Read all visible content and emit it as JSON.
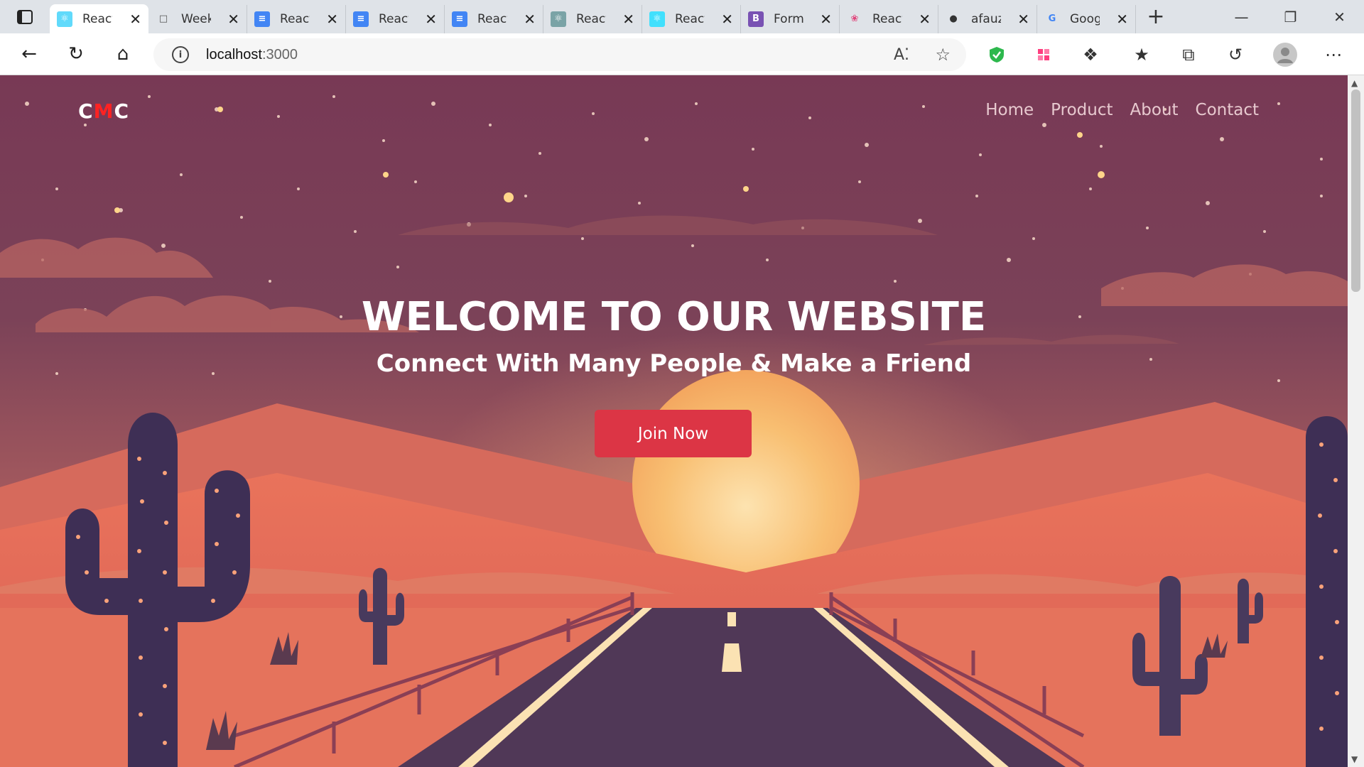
{
  "browser": {
    "tabs": [
      {
        "title": "React",
        "icon": "react-icon",
        "color": "#61dafb",
        "active": true
      },
      {
        "title": "Weekly",
        "icon": "page-icon",
        "color": "#555555",
        "active": false
      },
      {
        "title": "React",
        "icon": "docs-icon",
        "color": "#4285f4",
        "active": false
      },
      {
        "title": "React",
        "icon": "docs-icon",
        "color": "#4285f4",
        "active": false
      },
      {
        "title": "React",
        "icon": "docs-icon",
        "color": "#4285f4",
        "active": false
      },
      {
        "title": "React",
        "icon": "react-bootstrap-icon",
        "color": "#7aa3a6",
        "active": false
      },
      {
        "title": "React",
        "icon": "react-bootstrap-icon",
        "color": "#41e0fd",
        "active": false
      },
      {
        "title": "Forms",
        "icon": "bootstrap-icon",
        "color": "#7952b3",
        "active": false
      },
      {
        "title": "React",
        "icon": "react-pink-icon",
        "color": "#e0457b",
        "active": false
      },
      {
        "title": "afauzi",
        "icon": "github-icon",
        "color": "#333333",
        "active": false
      },
      {
        "title": "Google",
        "icon": "google-icon",
        "color": "#4285f4",
        "active": false
      }
    ],
    "url_host": "localhost",
    "url_port": ":3000"
  },
  "site": {
    "logo": {
      "c1": "C",
      "c2": "M",
      "c3": "C"
    },
    "menu": [
      "Home",
      "Product",
      "About",
      "Contact"
    ],
    "hero_title": "WELCOME TO OUR WEBSITE",
    "hero_subtitle": "Connect With Many People & Make a Friend",
    "cta_label": "Join Now",
    "colors": {
      "accent": "#dc3545",
      "sky": "#783c55",
      "sun": "#f6b56a"
    }
  }
}
